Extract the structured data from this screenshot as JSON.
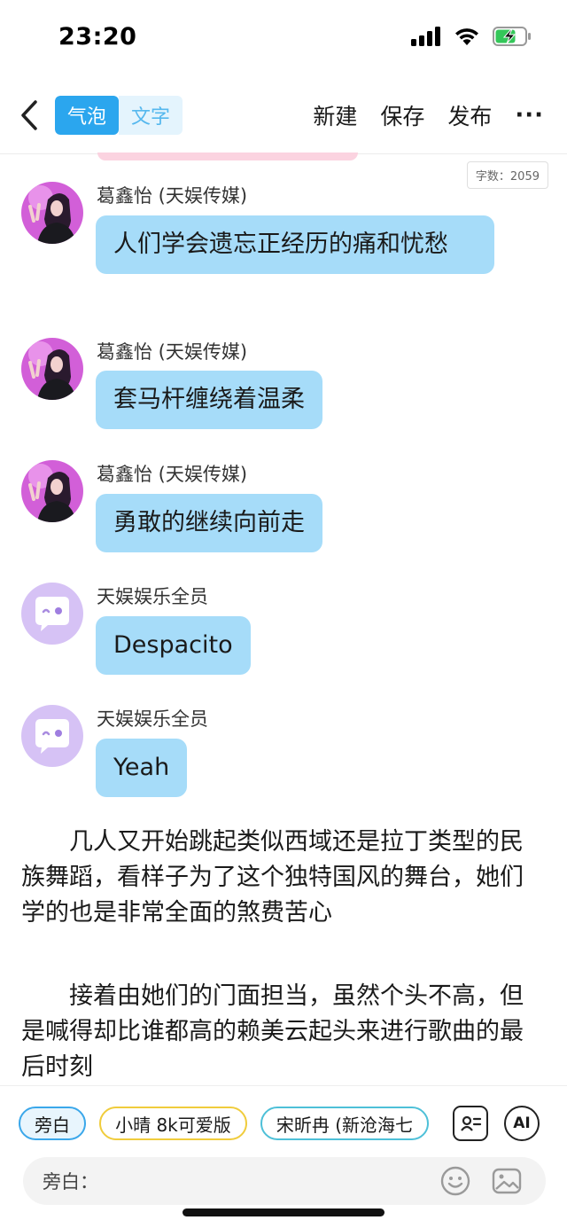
{
  "status_bar": {
    "time": "23:20"
  },
  "navbar": {
    "back_icon": "chevron-left-icon",
    "tabs": [
      {
        "label": "气泡",
        "active": true
      },
      {
        "label": "文字",
        "active": false
      }
    ],
    "new_label": "新建",
    "save_label": "保存",
    "publish_label": "发布",
    "more_label": "···"
  },
  "word_count": "字数：2059",
  "messages": [
    {
      "sender": "葛鑫怡 (天娱传媒)",
      "text": "人们学会遗忘正经历的痛和忧愁",
      "avatar": "photo-avatar"
    },
    {
      "sender": "葛鑫怡 (天娱传媒)",
      "text": "套马杆缠绕着温柔",
      "avatar": "photo-avatar"
    },
    {
      "sender": "葛鑫怡 (天娱传媒)",
      "text": "勇敢的继续向前走",
      "avatar": "photo-avatar"
    },
    {
      "sender": "天娱娱乐全员",
      "text": "Despacito",
      "avatar": "chat-bubble-avatar"
    },
    {
      "sender": "天娱娱乐全员",
      "text": "Yeah",
      "avatar": "chat-bubble-avatar"
    }
  ],
  "narration": [
    "几人又开始跳起类似西域还是拉丁类型的民族舞蹈，看样子为了这个独特国风的舞台，她们学的也是非常全面的煞费苦心",
    "接着由她们的门面担当，虽然个头不高，但是喊得却比谁都高的赖美云起头来进行歌曲的最后时刻"
  ],
  "bottom": {
    "chips": [
      "旁白",
      "小晴 8k可爱版",
      "宋昕冉 (新沧海七"
    ],
    "contact_icon": "contact-card-icon",
    "ai_label": "AI",
    "input_label": "旁白：",
    "emoji_icon": "smiley-icon",
    "image_icon": "image-icon"
  },
  "colors": {
    "accent": "#2ba6ee",
    "bubble": "#a6dcf9",
    "chip_yellow": "#f0cc3c",
    "chip_teal": "#4ec0d8"
  }
}
